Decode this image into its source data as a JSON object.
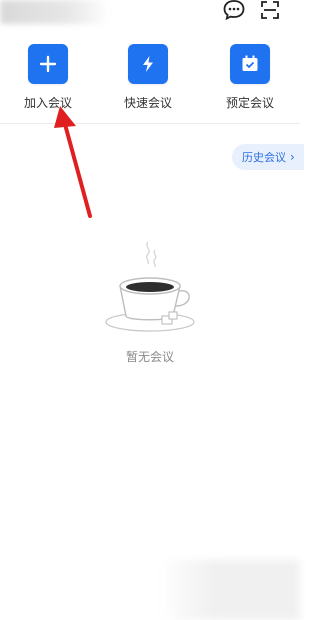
{
  "header": {
    "chat_icon": "chat-bubble-icon",
    "scan_icon": "scan-icon"
  },
  "actions": [
    {
      "label": "加入会议",
      "icon": "plus-icon"
    },
    {
      "label": "快速会议",
      "icon": "lightning-icon"
    },
    {
      "label": "预定会议",
      "icon": "calendar-check-icon"
    }
  ],
  "history_button": {
    "label": "历史会议",
    "chevron": "›"
  },
  "empty_state": {
    "text": "暂无会议",
    "icon": "coffee-cup-icon"
  },
  "colors": {
    "accent": "#1f72f0",
    "annotation_arrow": "#e02020"
  }
}
